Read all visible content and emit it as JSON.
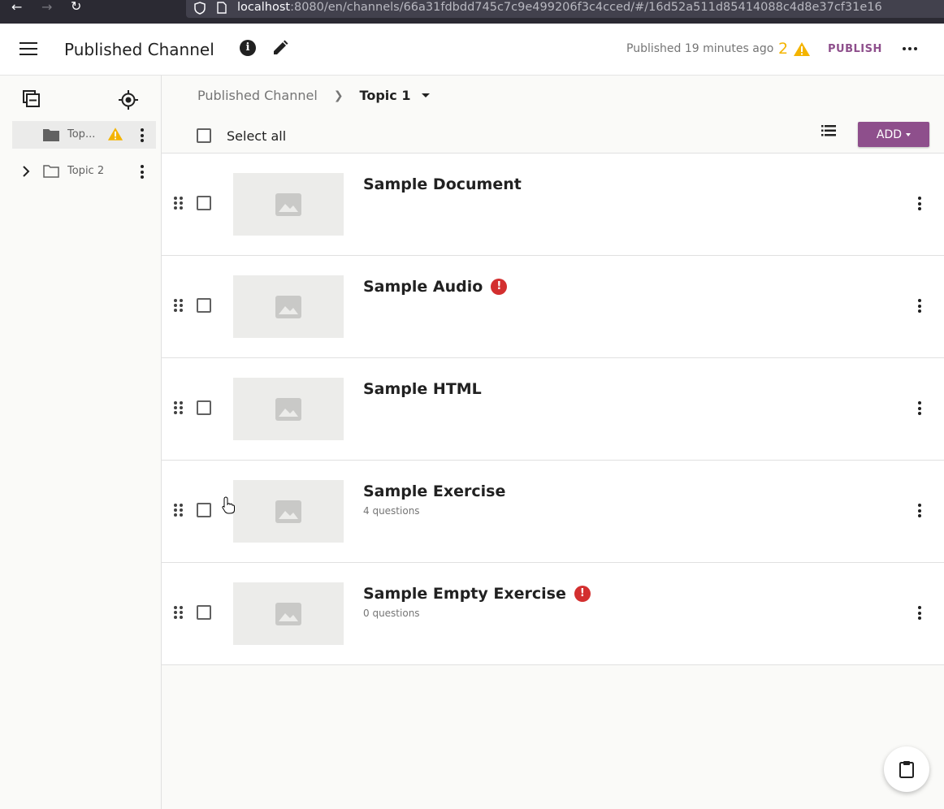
{
  "browser": {
    "url_host": "localhost",
    "url_rest": ":8080/en/channels/66a31fdbdd745c7c9e499206f3c4cced/#/16d52a511d85414088c4d8e37cf31e16"
  },
  "header": {
    "title": "Published Channel",
    "published_text": "Published 19 minutes ago",
    "warning_count": "2",
    "publish_label": "PUBLISH"
  },
  "sidebar": {
    "items": [
      {
        "label": "Top...",
        "active": true,
        "has_warning": true
      },
      {
        "label": "Topic 2",
        "active": false,
        "has_warning": false
      }
    ]
  },
  "breadcrumb": {
    "root": "Published Channel",
    "current": "Topic 1"
  },
  "toolbar": {
    "select_all_label": "Select all",
    "add_label": "ADD"
  },
  "content": {
    "items": [
      {
        "title": "Sample Document",
        "subtitle": "",
        "has_error": false
      },
      {
        "title": "Sample Audio",
        "subtitle": "",
        "has_error": true
      },
      {
        "title": "Sample HTML",
        "subtitle": "",
        "has_error": false
      },
      {
        "title": "Sample Exercise",
        "subtitle": "4 questions",
        "has_error": false
      },
      {
        "title": "Sample Empty Exercise",
        "subtitle": "0 questions",
        "has_error": true
      }
    ]
  },
  "colors": {
    "accent": "#8e4f8c",
    "warning": "#f4b400",
    "error": "#d32f2f"
  }
}
